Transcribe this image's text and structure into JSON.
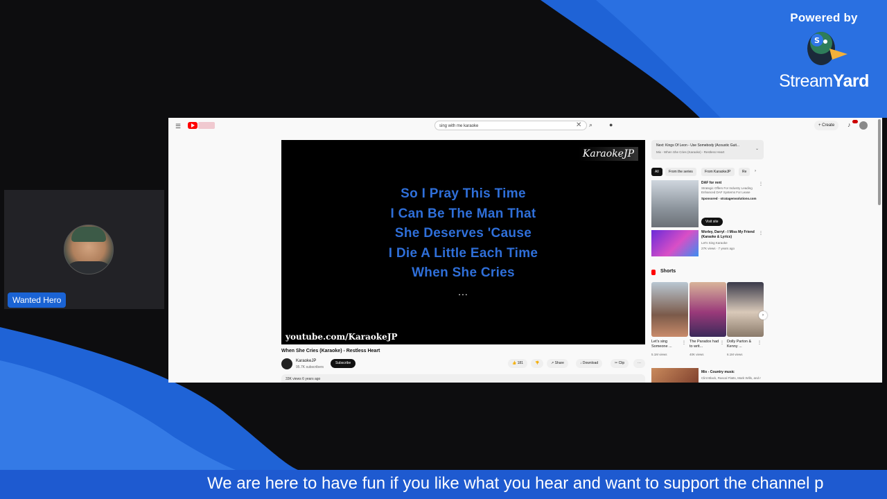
{
  "branding": {
    "powered_by": "Powered by",
    "name_bold": "Stream",
    "name_light": "Yard",
    "icon": "duck-logo-icon"
  },
  "participant": {
    "name": "Wanted Hero"
  },
  "youtube": {
    "search_query": "sing with me karaoke",
    "create_label": "Create",
    "player": {
      "logo": "KaraokeJP",
      "lyrics": [
        "So I Pray This Time",
        "I Can Be The Man That",
        "She Deserves 'Cause",
        "I Die A Little Each Time",
        "When She Cries"
      ],
      "dots": "...",
      "watermark": "youtube.com/KaraokeJP"
    },
    "video": {
      "title": "When She Cries (Karaoke) - Restless Heart",
      "channel": "KaraokeJP",
      "subscribers": "95.7K subscribers",
      "subscribe_label": "Subscribe",
      "likes": "181",
      "share_label": "Share",
      "download_label": "Download",
      "clip_label": "Clip",
      "meta": "33K views  6 years ago"
    },
    "up_next": {
      "title": "Next: Kings Of Leon - Use Somebody (Acoustic Guit...",
      "subtitle": "Mix - When She Cries (Karaoke) - Restless Heart"
    },
    "chips": [
      "All",
      "From the series",
      "From KaraokeJP",
      "Re"
    ],
    "ad": {
      "title": "DAF for rent",
      "description": "Strategic Offers For Industry Leading Enhanced DAF Systems For Lease",
      "sponsored": "Sponsored · stratagemsolutions.com",
      "visit_label": "Visit site"
    },
    "recommendation": {
      "title": "Worley, Darryl - I Miss My Friend (Karaoke & Lyrics)",
      "channel": "Let's Sing Karaoke",
      "views": "27K views · 7 years ago"
    },
    "shorts": {
      "heading": "Shorts",
      "items": [
        {
          "title": "Let's sing Someone ...",
          "views": "5.1M views"
        },
        {
          "title": "The Paradox had to writ...",
          "views": "40K views"
        },
        {
          "title": "Dolly Parton & Kenny ...",
          "views": "6.1M views"
        }
      ]
    },
    "mix": {
      "title": "Mix - Country music",
      "subtitle": "Clint Black, Rascal Flatts, Mark Wills, and more"
    }
  },
  "ticker": {
    "text": "We are here to have fun if you like what you hear and want to support the channel p"
  }
}
